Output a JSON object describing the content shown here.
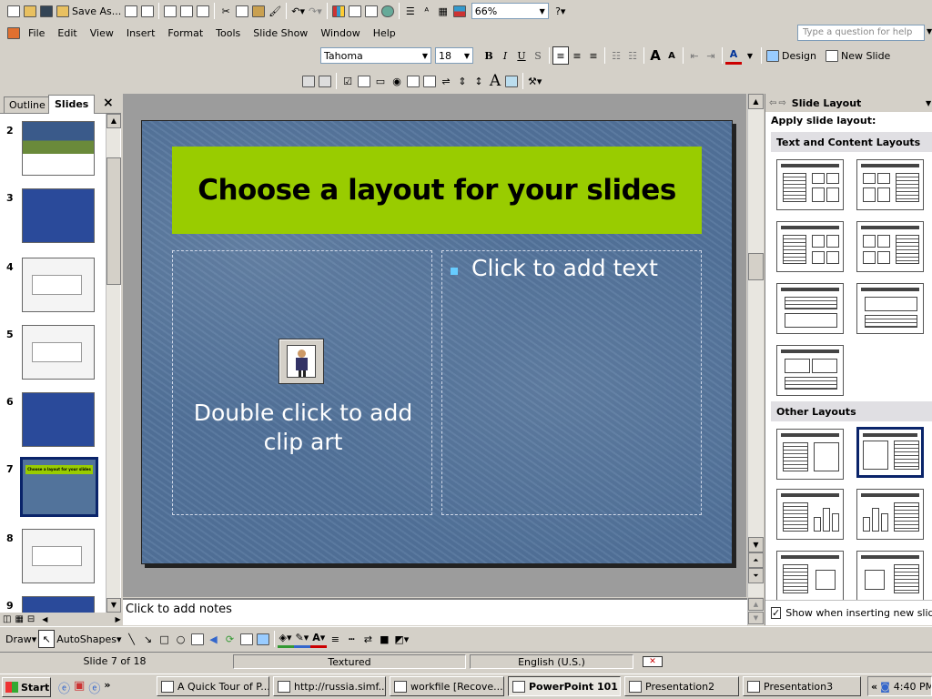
{
  "toolbar_standard": {
    "save_as_label": "Save As...",
    "zoom_value": "66%"
  },
  "menu": {
    "items": [
      "File",
      "Edit",
      "View",
      "Insert",
      "Format",
      "Tools",
      "Slide Show",
      "Window",
      "Help"
    ],
    "help_placeholder": "Type a question for help"
  },
  "formatting": {
    "font": "Tahoma",
    "size": "18",
    "bold": "B",
    "italic": "I",
    "underline": "U",
    "shadow": "S",
    "grow_font": "A",
    "shrink_font": "A",
    "font_color": "A",
    "design_label": "Design",
    "new_slide_label": "New Slide"
  },
  "pane_tabs": {
    "outline": "Outline",
    "slides": "Slides",
    "close": "×"
  },
  "thumbnails": [
    {
      "num": "2",
      "style": "photo"
    },
    {
      "num": "3",
      "style": "blue"
    },
    {
      "num": "4",
      "style": "white"
    },
    {
      "num": "5",
      "style": "white"
    },
    {
      "num": "6",
      "style": "blue"
    },
    {
      "num": "7",
      "style": "selected",
      "title": "Choose a layout for your slides"
    },
    {
      "num": "8",
      "style": "white"
    },
    {
      "num": "9",
      "style": "blue"
    }
  ],
  "slide": {
    "title": "Choose a layout for your slides",
    "bullet_text": "Click to add text",
    "clipart_text": "Double click to add clip art",
    "colors": {
      "background": "#52739b",
      "title_bar": "#99cc00",
      "bullet": "#66ccff"
    }
  },
  "notes": {
    "placeholder": "Click to add notes"
  },
  "task_pane": {
    "title": "Slide Layout",
    "apply_label": "Apply slide layout:",
    "section_text_content": "Text and Content Layouts",
    "section_other": "Other Layouts",
    "show_checkbox_label": "Show when inserting new slides",
    "show_checked": true
  },
  "drawing": {
    "draw_label": "Draw",
    "autoshapes_label": "AutoShapes"
  },
  "status": {
    "slide_position": "Slide 7 of 18",
    "design": "Textured",
    "language": "English (U.S.)"
  },
  "taskbar": {
    "start": "Start",
    "tasks": [
      {
        "label": "A Quick Tour of P...",
        "active": false
      },
      {
        "label": "http://russia.simf...",
        "active": false
      },
      {
        "label": "workfile [Recove...",
        "active": false
      },
      {
        "label": "PowerPoint 101",
        "active": true
      },
      {
        "label": "Presentation2",
        "active": false
      },
      {
        "label": "Presentation3",
        "active": false
      }
    ],
    "clock": "4:40 PM"
  }
}
